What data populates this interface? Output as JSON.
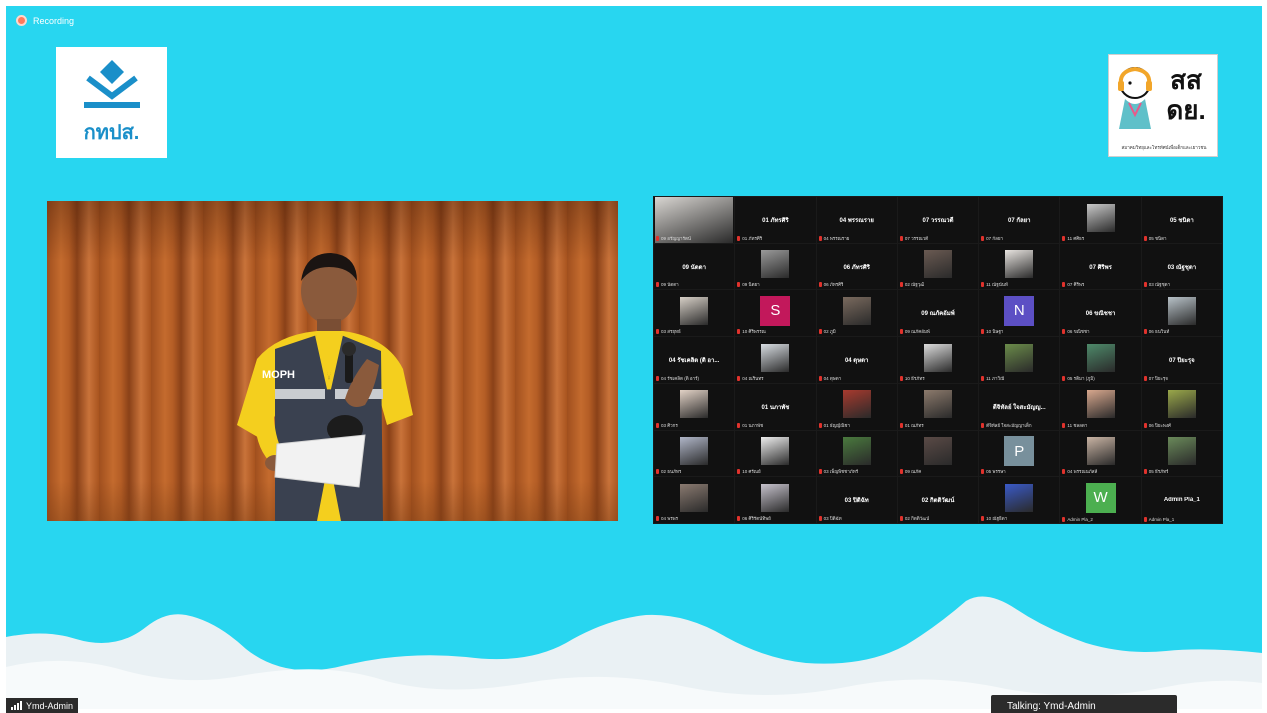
{
  "recording": {
    "label": "Recording"
  },
  "logo_left": {
    "text": "กทปส."
  },
  "logo_right": {
    "main_text": "สส\nดย.",
    "sub_text": "สมาคมวิทยุและโทรทัศน์เพื่อเด็กและเยาวชน"
  },
  "speaker_video": {
    "vest_text": "MOPH"
  },
  "gallery": {
    "tiles": [
      {
        "type": "video",
        "thumb_color": "#d9d6d2",
        "label": "09 อรัญญารัตน์"
      },
      {
        "type": "name",
        "name": "01 ภัทรศิริ",
        "label": "01 ภัทรศิริ"
      },
      {
        "type": "name",
        "name": "04 พรรณราย",
        "label": "04 พรรณราย"
      },
      {
        "type": "name",
        "name": "07 วรรณวดี",
        "label": "07 วรรณวดี"
      },
      {
        "type": "name",
        "name": "07 กัลยา",
        "label": "07 กัลยา"
      },
      {
        "type": "video",
        "thumb_color": "#c9c9c9",
        "label": "11 ศศิธร"
      },
      {
        "type": "name",
        "name": "05 ชนิดา",
        "label": "05 ชนิดา"
      },
      {
        "type": "name",
        "name": "09 นัดดา",
        "label": "09 นัดดา"
      },
      {
        "type": "video",
        "thumb_color": "#9a9a9a",
        "label": "09 นิตยา"
      },
      {
        "type": "name",
        "name": "06 ภัทรศิริ",
        "label": "06 ภัทรศิริ"
      },
      {
        "type": "video",
        "thumb_color": "#6a5a52",
        "label": "02 ณัฐวุฒิ"
      },
      {
        "type": "video",
        "thumb_color": "#e8e4e0",
        "label": "11 ณัฐนันท์"
      },
      {
        "type": "name",
        "name": "07 ศิริพร",
        "label": "07 ศิริพร"
      },
      {
        "type": "name",
        "name": "03 ณัฐชุดา",
        "label": "03 ณัฐชุดา"
      },
      {
        "type": "video",
        "thumb_color": "#d6cfc6",
        "label": "03 สรยุทธ์"
      },
      {
        "type": "letter",
        "letter": "S",
        "avatar_color": "#c2185b",
        "label": "10 ศิริพรรณ"
      },
      {
        "type": "video",
        "thumb_color": "#7a6a5e",
        "label": "02 ภูมิ"
      },
      {
        "type": "name",
        "name": "09 ณภัคอัมพ์",
        "label": "09 ณภัคอัมพ์"
      },
      {
        "type": "letter",
        "letter": "N",
        "avatar_color": "#5c4fc4",
        "label": "10 นิษฐา"
      },
      {
        "type": "name",
        "name": "06 ขณิชชา",
        "label": "06 ขณิชชา"
      },
      {
        "type": "video",
        "thumb_color": "#b8c2c8",
        "label": "06 ธนวินท์"
      },
      {
        "type": "name",
        "name": "04 รัชเคลิต (ดิ อา...",
        "label": "04 รัชเคลิต (ดิ อาร์)"
      },
      {
        "type": "video",
        "thumb_color": "#d8dde2",
        "label": "04 ณรินทร"
      },
      {
        "type": "name",
        "name": "04 ดุษดา",
        "label": "04 ดุษดา"
      },
      {
        "type": "video",
        "thumb_color": "#dcdcdc",
        "label": "10 ธีรภัทร"
      },
      {
        "type": "video",
        "thumb_color": "#6b8c4a",
        "label": "11 ภาวิณี"
      },
      {
        "type": "video",
        "thumb_color": "#4e8a6a",
        "label": "05 รติมา (ภูมิ)"
      },
      {
        "type": "name",
        "name": "07 ปิยะรุจ",
        "label": "07 ปิยะรุจ"
      },
      {
        "type": "video",
        "thumb_color": "#e2d2c6",
        "label": "03 ศิวกร"
      },
      {
        "type": "name",
        "name": "01 นภาพัช",
        "label": "01 นภาพัช"
      },
      {
        "type": "video",
        "thumb_color": "#a83a2e",
        "label": "01 ธัญญ์ณิชา"
      },
      {
        "type": "video",
        "thumb_color": "#8c7a6c",
        "label": "01 ณภัทร"
      },
      {
        "type": "name",
        "name": "ดีจิทัลย์ ใจสะมัญญ...",
        "label": "ดีจิทัลย์ ใจสะมัญญาเด็ก"
      },
      {
        "type": "video",
        "thumb_color": "#d8a88e",
        "label": "11 ชลลดา"
      },
      {
        "type": "video",
        "thumb_color": "#9aa84a",
        "label": "06 ปิยะพงศ์"
      },
      {
        "type": "video",
        "thumb_color": "#b0b6c8",
        "label": "02 ธนภัทร"
      },
      {
        "type": "video",
        "thumb_color": "#eeeeee",
        "label": "10 ศรัณย์"
      },
      {
        "type": "video",
        "thumb_color": "#4a7a3e",
        "label": "03 เพ็ญพิชชาภัทร์"
      },
      {
        "type": "video",
        "thumb_color": "#5a4a46",
        "label": "09 ณภัค"
      },
      {
        "type": "letter",
        "letter": "P",
        "avatar_color": "#78909c",
        "label": "05 พรรษา"
      },
      {
        "type": "video",
        "thumb_color": "#c9b4a4",
        "label": "04 พรรณนภัสส์"
      },
      {
        "type": "video",
        "thumb_color": "#6a8a5a",
        "label": "05 ธีรภัทร์"
      },
      {
        "type": "video",
        "thumb_color": "#8a7a70",
        "label": "04 พรพร"
      },
      {
        "type": "video",
        "thumb_color": "#c6c2cc",
        "label": "06 ศิริรัตน์ทิพย์"
      },
      {
        "type": "name",
        "name": "03 ปิติฉัท",
        "label": "03 ปิติฉัท"
      },
      {
        "type": "name",
        "name": "02 กิตติวัฒน์",
        "label": "02 กิตติวัฒน์"
      },
      {
        "type": "video",
        "thumb_color": "#3a5ac8",
        "label": "10 ณัฐธิดา"
      },
      {
        "type": "letter",
        "letter": "W",
        "avatar_color": "#4caf50",
        "label": "Admin Pla_2"
      },
      {
        "type": "name",
        "name": "Admin Pla_1",
        "label": "Admin Pla_1"
      }
    ]
  },
  "status": {
    "participant": "Ymd-Admin",
    "talking": "Talking: Ymd-Admin"
  }
}
